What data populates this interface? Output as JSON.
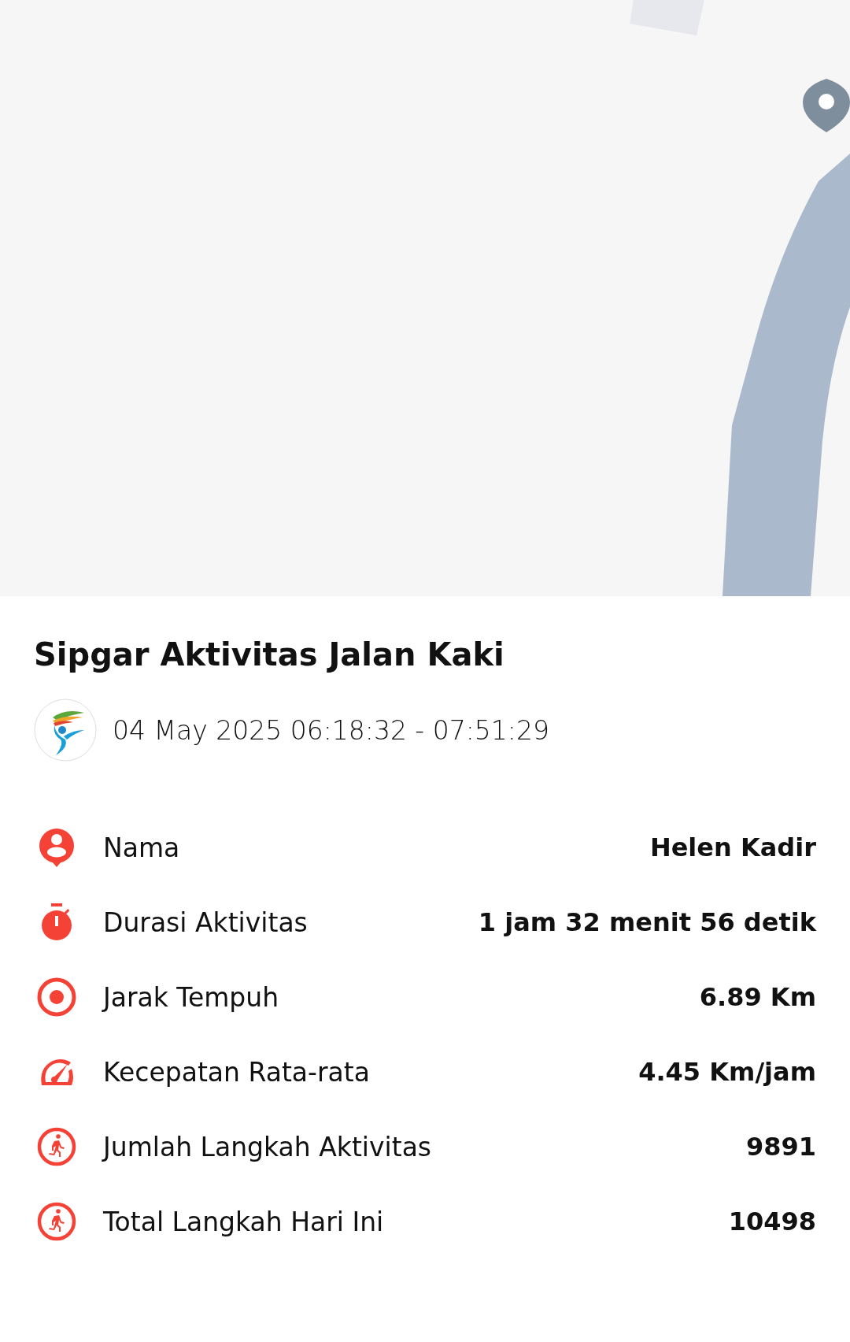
{
  "title": "Sipgar Aktivitas Jalan Kaki",
  "date": "04 May 2025 06:18:32 - 07:51:29",
  "stats": [
    {
      "kind": "person",
      "label": "Nama",
      "value": "Helen Kadir"
    },
    {
      "kind": "stopwatch",
      "label": "Durasi Aktivitas",
      "value": "1 jam 32 menit 56 detik"
    },
    {
      "kind": "target",
      "label": "Jarak Tempuh",
      "value": "6.89 Km"
    },
    {
      "kind": "gauge",
      "label": "Kecepatan Rata-rata",
      "value": "4.45 Km/jam"
    },
    {
      "kind": "walker",
      "label": "Jumlah Langkah Aktivitas",
      "value": "9891"
    },
    {
      "kind": "walker",
      "label": "Total Langkah Hari Ini",
      "value": "10498"
    }
  ]
}
